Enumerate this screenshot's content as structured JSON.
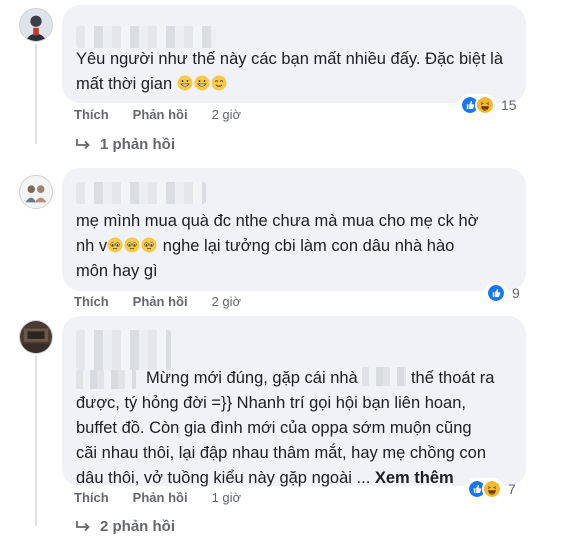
{
  "comments": [
    {
      "text": "Yêu người như thế này các bạn mất nhiều đấy. Đặc biệt là mất thời gian",
      "emoji": [
        "grinning-smile-emoji",
        "grinning-smile-emoji",
        "relieved-smile-emoji"
      ],
      "actions": {
        "like": "Thích",
        "reply": "Phản hồi",
        "time": "2 giờ"
      },
      "reaction_icons": [
        "like",
        "haha"
      ],
      "reaction_count": "15",
      "replies_label": "1 phản hồi"
    },
    {
      "text_line1": "mẹ mình mua quà đc nthe chưa mà mua cho mẹ ck hờ",
      "text_line2_prefix": "nh v",
      "emoji": [
        "pleading-face-emoji",
        "pleading-face-emoji",
        "pleading-face-emoji"
      ],
      "text_line2_suffix": " nghe lại tưởng cbi làm con dâu nhà hào",
      "text_line3": "môn hay gì",
      "actions": {
        "like": "Thích",
        "reply": "Phản hồi",
        "time": "2 giờ"
      },
      "reaction_icons": [
        "like"
      ],
      "reaction_count": "9"
    },
    {
      "line1_a": "Mừng mới đúng, gặp cái nhà",
      "line1_b": "thế thoát ra",
      "line2": "được, tý hỏng đời =}} Nhanh trí gọi hội bạn liên hoan,",
      "line3": "buffet đồ. Còn gia đình mới của oppa sớm muộn cũng",
      "line4": "cãi nhau thôi, lại đập nhau thâm mắt, hay mẹ chồng con",
      "line5": "dâu thôi, vở tuồng kiểu này gặp ngoài ...",
      "see_more": "Xem thêm",
      "actions": {
        "like": "Thích",
        "reply": "Phản hồi",
        "time": "1 giờ"
      },
      "reaction_icons": [
        "like",
        "haha"
      ],
      "reaction_count": "7",
      "replies_label": "2 phản hồi"
    }
  ],
  "colors": {
    "like_blue": "#1877f2",
    "haha_yellow": "#f7b928",
    "bubble": "#f0f2f5",
    "meta_gray": "#65676b"
  }
}
